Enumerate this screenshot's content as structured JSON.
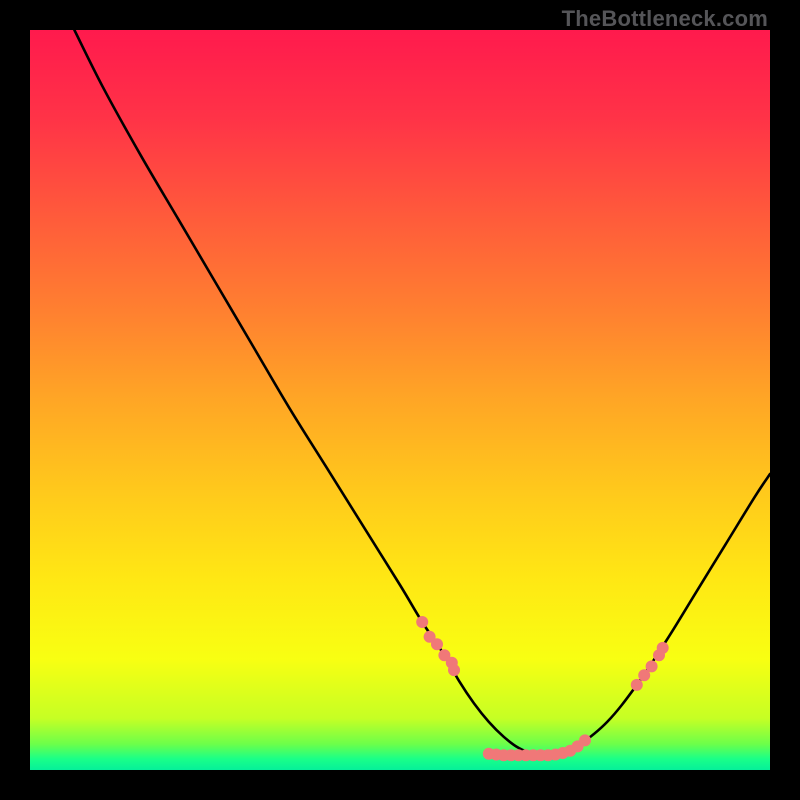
{
  "watermark": "TheBottleneck.com",
  "chart_data": {
    "type": "line",
    "title": "",
    "xlabel": "",
    "ylabel": "",
    "xlim": [
      0,
      100
    ],
    "ylim": [
      0,
      100
    ],
    "grid": false,
    "legend": false,
    "curve": {
      "name": "bottleneck-curve",
      "x": [
        6,
        10,
        15,
        20,
        25,
        30,
        35,
        40,
        45,
        50,
        53,
        56,
        58,
        60,
        62,
        64,
        66,
        68,
        70,
        72,
        74,
        78,
        82,
        86,
        90,
        94,
        98,
        100
      ],
      "y": [
        100,
        92,
        83,
        74.5,
        66,
        57.5,
        49,
        41,
        33,
        25,
        20,
        15.5,
        12,
        9,
        6.5,
        4.5,
        3,
        2.2,
        2,
        2.3,
        3.2,
        6.5,
        11.5,
        17.5,
        24,
        30.5,
        37,
        40
      ]
    },
    "markers": {
      "name": "data-points",
      "color": "#f07878",
      "points": [
        {
          "x": 53,
          "y": 20
        },
        {
          "x": 54,
          "y": 18
        },
        {
          "x": 55,
          "y": 17
        },
        {
          "x": 56,
          "y": 15.5
        },
        {
          "x": 57,
          "y": 14.5
        },
        {
          "x": 57.3,
          "y": 13.5
        },
        {
          "x": 62,
          "y": 2.2
        },
        {
          "x": 63,
          "y": 2.1
        },
        {
          "x": 64,
          "y": 2.0
        },
        {
          "x": 65,
          "y": 2.0
        },
        {
          "x": 66,
          "y": 2.0
        },
        {
          "x": 67,
          "y": 2.0
        },
        {
          "x": 68,
          "y": 2.0
        },
        {
          "x": 69,
          "y": 2.0
        },
        {
          "x": 70,
          "y": 2.0
        },
        {
          "x": 71,
          "y": 2.1
        },
        {
          "x": 72,
          "y": 2.3
        },
        {
          "x": 73,
          "y": 2.6
        },
        {
          "x": 74,
          "y": 3.2
        },
        {
          "x": 75,
          "y": 4.0
        },
        {
          "x": 82,
          "y": 11.5
        },
        {
          "x": 83,
          "y": 12.8
        },
        {
          "x": 84,
          "y": 14
        },
        {
          "x": 85,
          "y": 15.5
        },
        {
          "x": 85.5,
          "y": 16.5
        }
      ]
    },
    "gradient_stops": [
      {
        "offset": 0.0,
        "color": "#ff1a4d"
      },
      {
        "offset": 0.12,
        "color": "#ff3347"
      },
      {
        "offset": 0.25,
        "color": "#ff5a3b"
      },
      {
        "offset": 0.38,
        "color": "#ff8030"
      },
      {
        "offset": 0.5,
        "color": "#ffa625"
      },
      {
        "offset": 0.62,
        "color": "#ffc81c"
      },
      {
        "offset": 0.74,
        "color": "#ffe714"
      },
      {
        "offset": 0.85,
        "color": "#f8ff12"
      },
      {
        "offset": 0.93,
        "color": "#c6ff24"
      },
      {
        "offset": 0.965,
        "color": "#6cff4a"
      },
      {
        "offset": 0.985,
        "color": "#1aff88"
      },
      {
        "offset": 1.0,
        "color": "#05f09a"
      }
    ]
  }
}
